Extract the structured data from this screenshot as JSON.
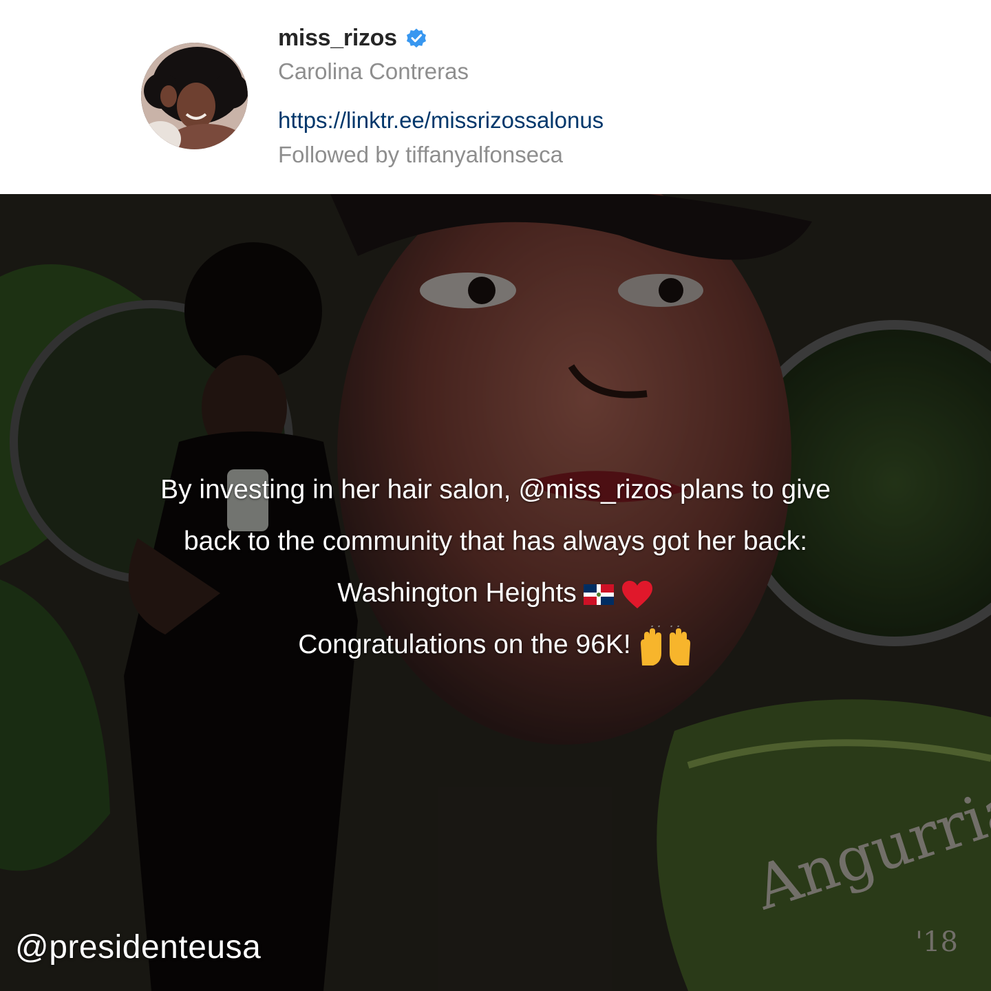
{
  "profile": {
    "username": "miss_rizos",
    "display_name": "Carolina Contreras",
    "link": "https://linktr.ee/missrizossalonus",
    "followed_by": "Followed by tiffanyalfonseca",
    "verified_color": "#3897f0"
  },
  "post": {
    "caption_lines": [
      "By investing in her hair salon, @miss_rizos plans to give",
      "back to the community that has always got her back:",
      "Washington Heights",
      "Congratulations on the 96K!"
    ],
    "emojis": [
      "dominican-flag-icon",
      "red-heart-icon",
      "raising-hands-icon"
    ],
    "mural_signature": "Angurria",
    "mural_signature_year": "'18",
    "credit": "@presidenteusa"
  }
}
